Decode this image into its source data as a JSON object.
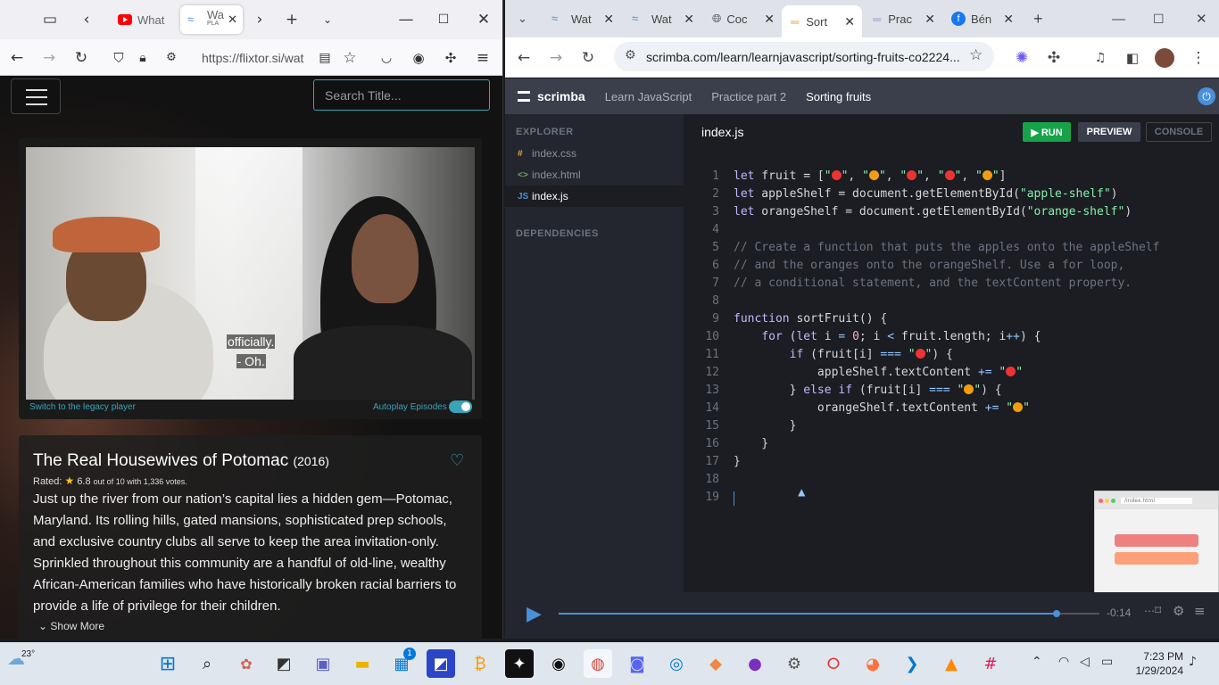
{
  "firefox": {
    "tabs": [
      {
        "label": "What"
      },
      {
        "label": "Wa",
        "sublabel": "PLA"
      }
    ],
    "url": "https://flixtor.si/wat",
    "search_placeholder": "Search Title...",
    "subtitles": [
      "officially.",
      "- Oh."
    ],
    "legacy_link": "Switch to the legacy player",
    "autoplay_label": "Autoplay Episodes",
    "show": {
      "title": "The Real Housewives of Potomac",
      "year": "(2016)",
      "rated_label": "Rated:",
      "rating": "6.8",
      "rating_suffix": "out of 10 with 1,336 votes.",
      "description": "Just up the river from our nation’s capital lies a hidden gem—Potomac, Maryland. Its rolling hills, gated mansions, sophisticated prep schools, and exclusive country clubs all serve to keep the area invitation-only. Sprinkled throughout this community are a handful of old-line, wealthy African-American families who have historically broken racial barriers to provide a life of privilege for their children.",
      "show_more": "Show More"
    }
  },
  "chrome": {
    "tabs": [
      {
        "label": "Wat"
      },
      {
        "label": "Wat"
      },
      {
        "label": "Coc"
      },
      {
        "label": "Sort"
      },
      {
        "label": "Prac"
      },
      {
        "label": "Bén"
      }
    ],
    "url": "scrimba.com/learn/learnjavascript/sorting-fruits-co2224..."
  },
  "scrimba": {
    "logo": "scrimba",
    "breadcrumbs": [
      "Learn JavaScript",
      "Practice part 2",
      "Sorting fruits"
    ],
    "explorer_label": "EXPLORER",
    "dependencies_label": "DEPENDENCIES",
    "files": [
      {
        "icon": "#",
        "name": "index.css",
        "color": "#e8a23a"
      },
      {
        "icon": "<>",
        "name": "index.html",
        "color": "#6ab04c"
      },
      {
        "icon": "JS",
        "name": "index.js",
        "color": "#4a90d9"
      }
    ],
    "active_file": "index.js",
    "run_label": "▶ RUN",
    "preview_label": "PREVIEW",
    "console_label": "CONSOLE",
    "time_remaining": "-0:14",
    "progress": 0.92,
    "mini_preview_url": "/index.html",
    "line_numbers": [
      "1",
      "2",
      "3",
      "4",
      "5",
      "6",
      "7",
      "8",
      "9",
      "10",
      "11",
      "12",
      "13",
      "14",
      "15",
      "16",
      "17",
      "18",
      "19"
    ]
  },
  "taskbar": {
    "weather_temp": "23°",
    "time": "7:23 PM",
    "date": "1/29/2024",
    "store_badge": "1"
  },
  "colors": {
    "accent_teal": "#39a3b8",
    "scrimba_run": "#16a34a",
    "scrimba_header": "#3a3f4b"
  }
}
